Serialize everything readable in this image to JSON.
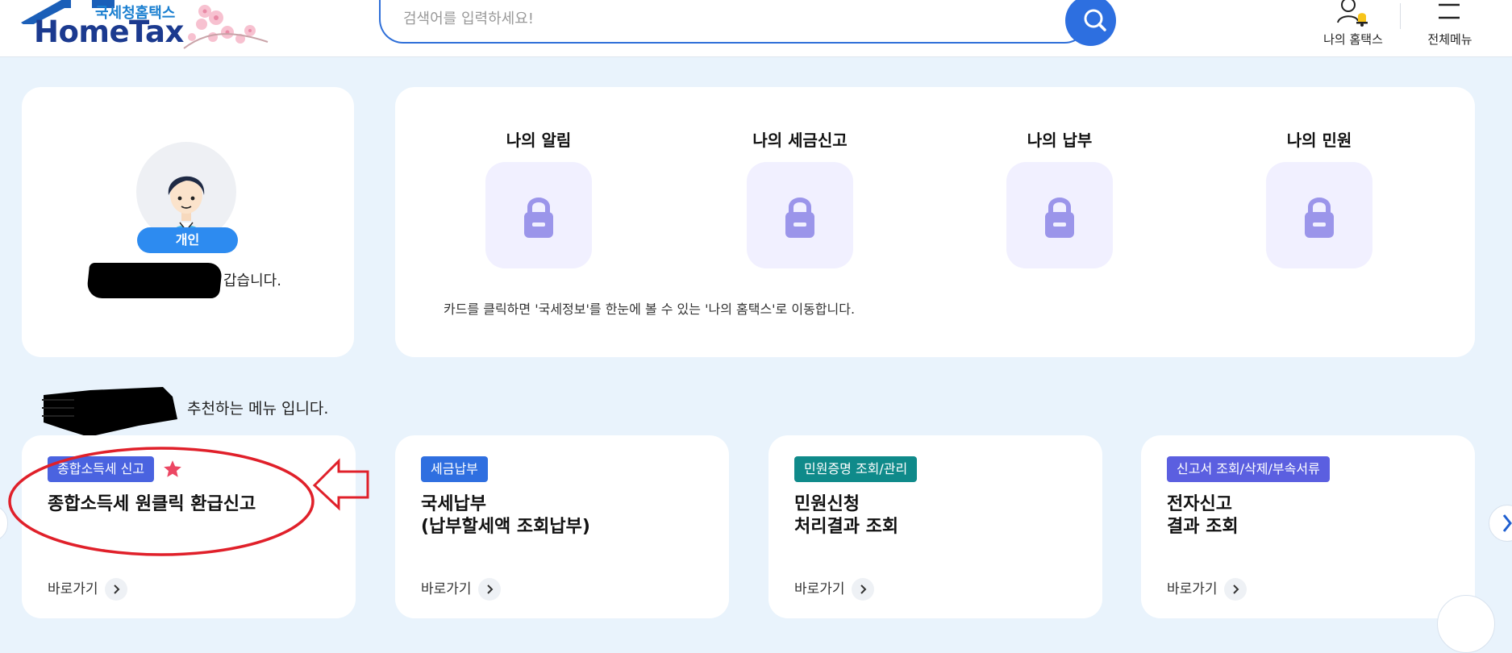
{
  "header": {
    "logo_sub": "국세청홈택스",
    "logo_main": "HomeTax",
    "search_placeholder": "검색어를 입력하세요!",
    "my_hometax": "나의 홈택스",
    "all_menu": "전체메뉴"
  },
  "profile": {
    "badge": "개인",
    "greeting_suffix": "갑습니다."
  },
  "mine": {
    "items": [
      {
        "title": "나의 알림",
        "icon": "lock-icon"
      },
      {
        "title": "나의 세금신고",
        "icon": "lock-icon"
      },
      {
        "title": "나의 납부",
        "icon": "lock-icon"
      },
      {
        "title": "나의 민원",
        "icon": "lock-icon"
      }
    ],
    "note": "카드를 클릭하면 '국세정보'를 한눈에 볼 수 있는 '나의 홈택스'로 이동합니다."
  },
  "recommend": {
    "title_suffix": "추천하는 메뉴 입니다.",
    "cards": [
      {
        "tag": "종합소득세 신고",
        "tag_color": "#4a63e0",
        "title1": "종합소득세 원클릭 환급신고",
        "title2": "",
        "link": "바로가기",
        "favorite": true
      },
      {
        "tag": "세금납부",
        "tag_color": "#2f6fe0",
        "title1": "국세납부",
        "title2": "(납부할세액 조회납부)",
        "link": "바로가기",
        "favorite": false
      },
      {
        "tag": "민원증명 조회/관리",
        "tag_color": "#0f8a8a",
        "title1": "민원신청",
        "title2": "처리결과 조회",
        "link": "바로가기",
        "favorite": false
      },
      {
        "tag": "신고서 조회/삭제/부속서류",
        "tag_color": "#5b5fe0",
        "title1": "전자신고",
        "title2": "결과 조회",
        "link": "바로가기",
        "favorite": false
      }
    ]
  }
}
